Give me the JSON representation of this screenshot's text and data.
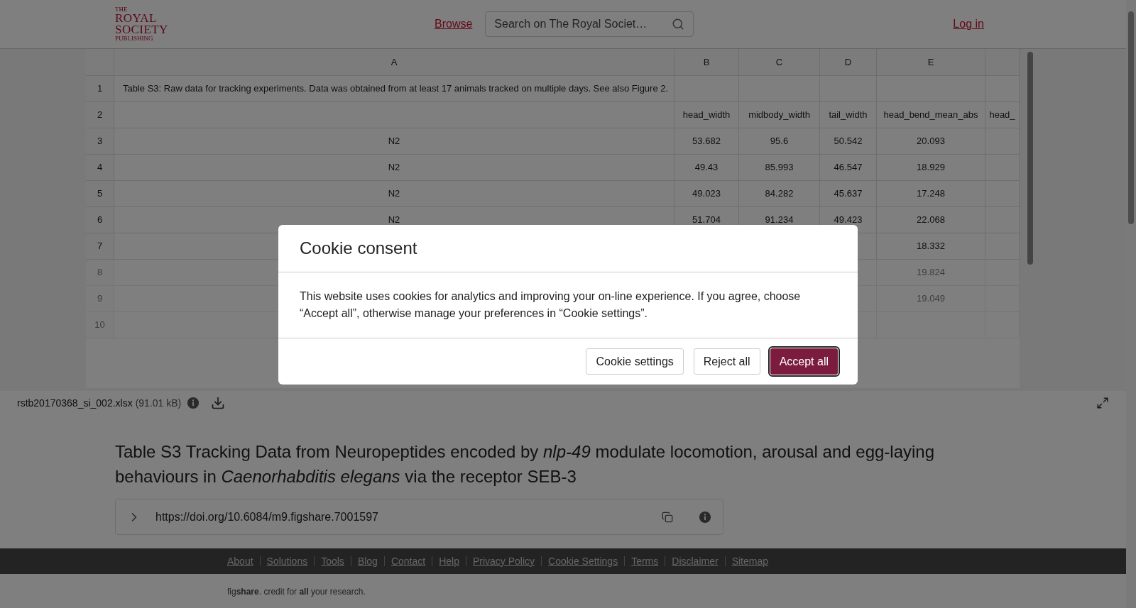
{
  "header": {
    "logo": [
      "THE",
      "ROYAL",
      "SOCIETY",
      "PUBLISHING"
    ],
    "browse": "Browse",
    "search": {
      "placeholder": "Search on The Royal Societ…"
    },
    "login": "Log in"
  },
  "sheet": {
    "columns": [
      "A",
      "B",
      "C",
      "D",
      "E"
    ],
    "rows": [
      {
        "number": "1",
        "faded": false,
        "cells": [
          "Table S3: Raw data for tracking experiments. Data was obtained from at least 17 animals tracked on multiple days. See also Figure 2.",
          null,
          null,
          null,
          null,
          null
        ]
      },
      {
        "number": "2",
        "faded": false,
        "cells": [
          null,
          "head_width",
          "midbody_width",
          "tail_width",
          "head_bend_mean_abs",
          "head_"
        ]
      },
      {
        "number": "3",
        "faded": false,
        "cells": [
          "N2",
          "53.682",
          "95.6",
          "50.542",
          "20.093",
          null
        ]
      },
      {
        "number": "4",
        "faded": false,
        "cells": [
          "N2",
          "49.43",
          "85.993",
          "46.547",
          "18.929",
          null
        ]
      },
      {
        "number": "5",
        "faded": false,
        "cells": [
          "N2",
          "49.023",
          "84.282",
          "45.637",
          "17.248",
          null
        ]
      },
      {
        "number": "6",
        "faded": false,
        "cells": [
          "N2",
          "51.704",
          "91.234",
          "49.423",
          "22.068",
          null
        ]
      },
      {
        "number": "7",
        "faded": false,
        "cells": [
          null,
          null,
          null,
          null,
          "18.332",
          null
        ]
      },
      {
        "number": "8",
        "faded": true,
        "cells": [
          null,
          null,
          null,
          null,
          "19.824",
          null
        ]
      },
      {
        "number": "9",
        "faded": true,
        "cells": [
          null,
          null,
          null,
          null,
          "19.049",
          null
        ]
      },
      {
        "number": "10",
        "faded": true,
        "cells": [
          null,
          null,
          null,
          null,
          null,
          null
        ]
      }
    ]
  },
  "file": {
    "name": "rstb20170368_si_002.xlsx",
    "size": "(91.01 kB)"
  },
  "title": "Table S3 Tracking Data from Neuropeptides encoded by *nlp-49* modulate locomotion, arousal and egg-laying behaviours in *Caenorhabditis elegans* via the receptor SEB-3",
  "doi": "https://doi.org/10.6084/m9.figshare.7001597",
  "footer": {
    "links": [
      "About",
      "Solutions",
      "Tools",
      "Blog",
      "Contact",
      "Help",
      "Privacy Policy",
      "Cookie Settings",
      "Terms",
      "Disclaimer",
      "Sitemap"
    ],
    "tagline": "fig**share**. credit for **all** your research."
  },
  "modal": {
    "title": "Cookie consent",
    "text": "This website uses cookies for analytics and improving your on-line experience. If you agree, choose “Accept all”, otherwise manage your preferences in “Cookie settings”.",
    "buttons": [
      {
        "label": "Cookie settings",
        "primary": false
      },
      {
        "label": "Reject all",
        "primary": false
      },
      {
        "label": "Accept all",
        "primary": true
      }
    ]
  }
}
